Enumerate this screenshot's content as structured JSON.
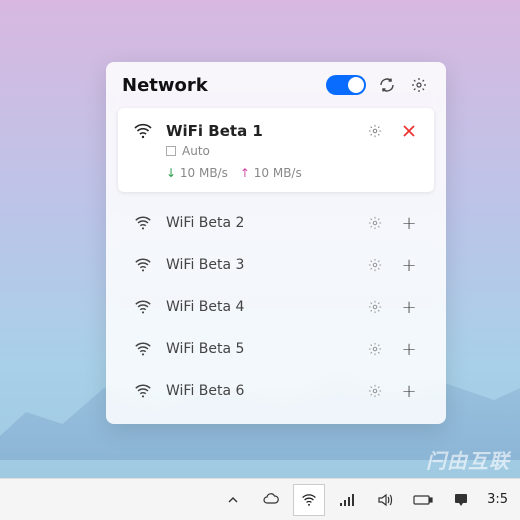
{
  "header": {
    "title": "Network"
  },
  "connected": {
    "name": "WiFi Beta 1",
    "auto_label": "Auto",
    "down": "10 MB/s",
    "up": "10 MB/s"
  },
  "networks": [
    {
      "name": "WiFi Beta 2"
    },
    {
      "name": "WiFi Beta 3"
    },
    {
      "name": "WiFi Beta 4"
    },
    {
      "name": "WiFi Beta 5"
    },
    {
      "name": "WiFi Beta 6"
    }
  ],
  "taskbar": {
    "time": "3:5"
  },
  "watermark": "闩由互联"
}
